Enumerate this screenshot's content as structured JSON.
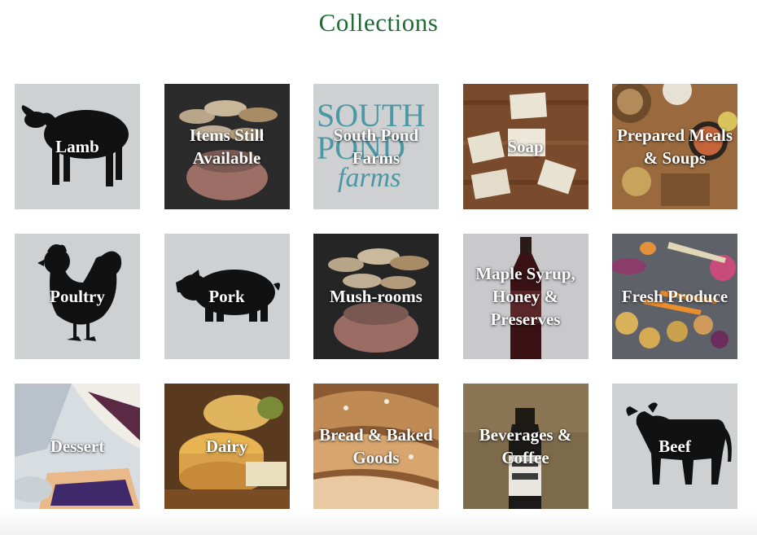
{
  "page": {
    "title": "Collections"
  },
  "collections": [
    {
      "label": "Lamb",
      "icon": "sheep-icon"
    },
    {
      "label": "Items Still Available",
      "icon": "mushroom-photo"
    },
    {
      "label": "South Pond Farms",
      "icon": "farm-logo"
    },
    {
      "label": "Soap",
      "icon": "soap-photo"
    },
    {
      "label": "Prepared Meals & Soups",
      "icon": "meals-photo"
    },
    {
      "label": "Poultry",
      "icon": "chicken-icon"
    },
    {
      "label": "Pork",
      "icon": "pig-icon"
    },
    {
      "label": "Mush-rooms",
      "icon": "mushroom-photo"
    },
    {
      "label": "Maple Syrup, Honey & Preserves",
      "icon": "syrup-bottle-photo"
    },
    {
      "label": "Fresh Produce",
      "icon": "produce-photo"
    },
    {
      "label": "Dessert",
      "icon": "pie-photo"
    },
    {
      "label": "Dairy",
      "icon": "cheese-photo"
    },
    {
      "label": "Bread & Baked Goods",
      "icon": "bread-photo"
    },
    {
      "label": "Beverages & Coffee",
      "icon": "coffee-bottle-photo"
    },
    {
      "label": "Beef",
      "icon": "cow-icon"
    }
  ],
  "logo": {
    "line1": "SOUTH",
    "line2": "POND",
    "line3": "farms",
    "color": "#4b97a3"
  },
  "colors": {
    "title": "#1f6b34",
    "tile_gray": "#cfd0d2",
    "silhouette": "#111111"
  }
}
